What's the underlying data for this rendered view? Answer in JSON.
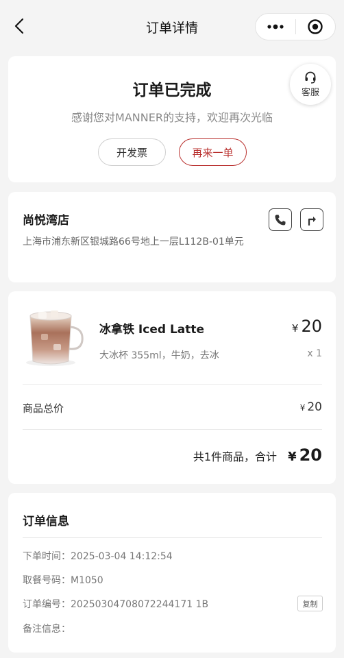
{
  "nav": {
    "title": "订单详情",
    "back_icon": "chevron-left-icon",
    "more_icon": "more-dots-icon",
    "close_icon": "target-close-icon"
  },
  "status": {
    "title": "订单已完成",
    "subtitle": "感谢您对MANNER的支持，欢迎再次光临",
    "invoice_label": "开发票",
    "reorder_label": "再来一单",
    "service_label": "客服",
    "accent_color": "#b9302e"
  },
  "store": {
    "name": "尚悦湾店",
    "address": "上海市浦东新区银城路66号地上一层L112B-01单元"
  },
  "items": {
    "list": [
      {
        "name": "冰拿铁 Iced Latte",
        "spec": "大冰杯 355ml，牛奶，去冰",
        "currency": "¥",
        "price": "20",
        "qty": "x 1"
      }
    ],
    "subtotal_label": "商品总价",
    "subtotal_currency": "¥",
    "subtotal_value": "20",
    "total_text": "共1件商品，合计",
    "total_currency": "¥",
    "total_value": "20"
  },
  "info": {
    "title": "订单信息",
    "order_time": "下单时间：2025-03-04 14:12:54",
    "pickup_code": "取餐号码：M1050",
    "order_number": "订单编号：20250304708072244171 1B",
    "note": "备注信息：",
    "copy_label": "复制"
  }
}
